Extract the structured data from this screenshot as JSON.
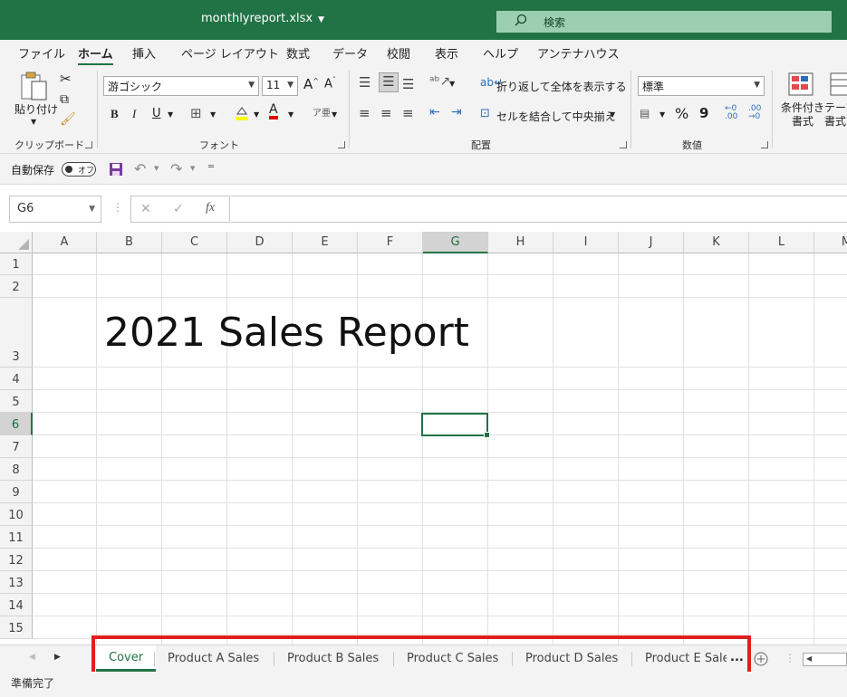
{
  "window": {
    "title": "monthlyreport.xlsx",
    "search_label": "検索"
  },
  "menu": {
    "tabs": [
      {
        "label": "ファイル",
        "active": false
      },
      {
        "label": "ホーム",
        "active": true
      },
      {
        "label": "挿入",
        "active": false
      },
      {
        "label": "ページ レイアウト",
        "active": false
      },
      {
        "label": "数式",
        "active": false
      },
      {
        "label": "データ",
        "active": false
      },
      {
        "label": "校閲",
        "active": false
      },
      {
        "label": "表示",
        "active": false
      },
      {
        "label": "ヘルプ",
        "active": false
      },
      {
        "label": "アンテナハウス",
        "active": false
      }
    ]
  },
  "ribbon": {
    "clipboard": {
      "label": "クリップボード",
      "paste": "貼り付け"
    },
    "font": {
      "label": "フォント",
      "font_name": "游ゴシック",
      "font_size": "11",
      "grow": "A^",
      "shrink": "Aˇ",
      "bold": "B",
      "italic": "I",
      "underline": "U"
    },
    "alignment": {
      "label": "配置",
      "wrap_text": "折り返して全体を表示する",
      "merge_center": "セルを結合して中央揃え"
    },
    "number": {
      "label": "数値",
      "format": "標準",
      "percent": "%",
      "comma": "9"
    },
    "styles": {
      "conditional": "条件付き\n書式",
      "table": "テーブ\n書式"
    }
  },
  "qat": {
    "autosave_label": "自動保存",
    "autosave_state": "オフ"
  },
  "formula_bar": {
    "name_box": "G6",
    "cancel": "✕",
    "enter": "✓",
    "fx": "fx",
    "content": ""
  },
  "grid": {
    "columns": [
      "A",
      "B",
      "C",
      "D",
      "E",
      "F",
      "G",
      "H",
      "I",
      "J",
      "K",
      "L",
      "M"
    ],
    "rows": [
      "1",
      "2",
      "3",
      "4",
      "5",
      "6",
      "7",
      "8",
      "9",
      "10",
      "11",
      "12",
      "13",
      "14",
      "15"
    ],
    "selected_column": "G",
    "selected_row": "6",
    "title_text": "2021 Sales Report"
  },
  "sheets": {
    "tabs": [
      {
        "label": "Cover",
        "active": true
      },
      {
        "label": "Product A Sales",
        "active": false
      },
      {
        "label": "Product B Sales",
        "active": false
      },
      {
        "label": "Product C Sales",
        "active": false
      },
      {
        "label": "Product D Sales",
        "active": false
      },
      {
        "label": "Product E Sale",
        "active": false
      }
    ],
    "more": "..."
  },
  "status": {
    "text": "準備完了"
  },
  "colors": {
    "accent": "#217346",
    "highlight": "#e01e1e"
  }
}
